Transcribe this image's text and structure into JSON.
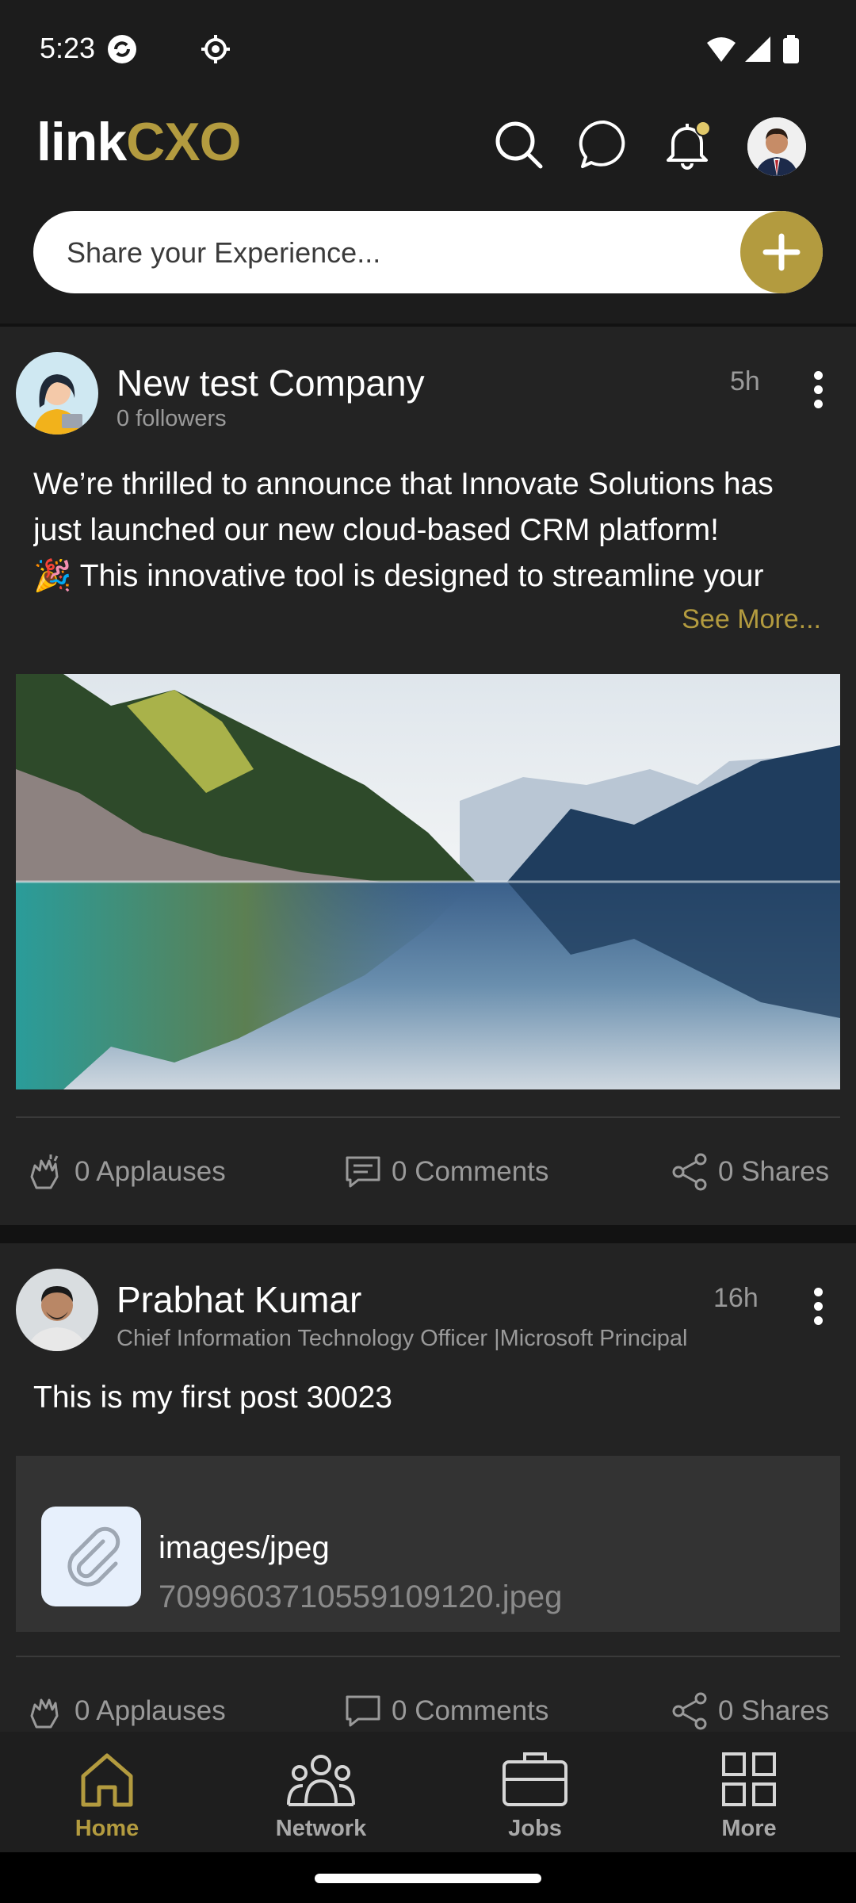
{
  "status_bar": {
    "time": "5:23"
  },
  "header": {
    "logo_part1": "link",
    "logo_part2": "CXO",
    "share_placeholder": "Share your Experience..."
  },
  "posts": [
    {
      "author": "New test Company",
      "subtitle": "0 followers",
      "time": "5h",
      "text_lines": [
        "We’re thrilled to announce that Innovate Solutions has",
        "just launched our new cloud-based CRM platform!",
        "🎉 This innovative tool is designed to streamline your"
      ],
      "see_more": "See More...",
      "applauses": "0 Applauses",
      "comments": "0 Comments",
      "shares": "0 Shares"
    },
    {
      "author": "Prabhat Kumar",
      "subtitle": "Chief Information Technology Officer |Microsoft Principal",
      "time": "16h",
      "text": "This is my first post 30023",
      "attachment_type": "images/jpeg",
      "attachment_file": "7099603710559109120.jpeg",
      "applauses": "0 Applauses",
      "comments": "0 Comments",
      "shares": "0 Shares"
    }
  ],
  "bottom_nav": [
    {
      "label": "Home",
      "icon": "home-icon",
      "active": true
    },
    {
      "label": "Network",
      "icon": "network-icon",
      "active": false
    },
    {
      "label": "Jobs",
      "icon": "briefcase-icon",
      "active": false
    },
    {
      "label": "More",
      "icon": "grid-icon",
      "active": false
    }
  ],
  "colors": {
    "accent": "#b39b3f",
    "background": "#121212",
    "card": "#232323"
  }
}
